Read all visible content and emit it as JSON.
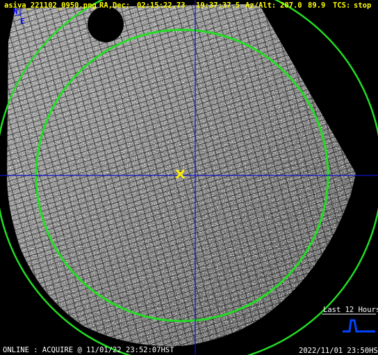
{
  "header": {
    "filename": "asiva_221102_0950.png",
    "radec_label": "RA,Dec:",
    "ra": "02:15:22.73",
    "dec": "19:37:37.5",
    "azalt_label": "Az/Alt:",
    "az": "207.0",
    "alt": "89.9",
    "tcs_label": "TCS:",
    "tcs_status": "stop"
  },
  "compass": {
    "north": "N",
    "east": "E"
  },
  "legend": {
    "title": "Last 12 Hours"
  },
  "footer": {
    "status": "ONLINE : ACQUIRE @ 11/01/22 23:52:07HST",
    "timestamp": "2022/11/01 23:50HST"
  },
  "colors": {
    "background": "#000000",
    "header_text": "#ffff00",
    "circles": "#22dd22",
    "crosshair": "#1010c8",
    "target_marker": "#ffee00",
    "compass": "#0000ff",
    "footer_text": "#ffffff",
    "sparkline": "#0044ff"
  }
}
